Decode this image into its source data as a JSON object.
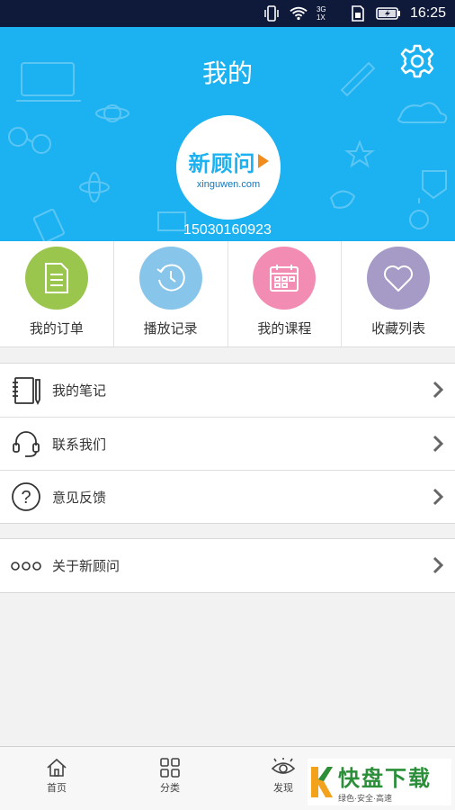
{
  "status_bar": {
    "network_label": "3G",
    "network_sub": "1X",
    "time": "16:25"
  },
  "header": {
    "title": "我的",
    "settings_icon": "gear-icon",
    "logo_name": "新顾问",
    "logo_url": "xinguwen.com",
    "phone": "15030160923",
    "background": "#1cb1f0"
  },
  "quick_actions": [
    {
      "label": "我的订单",
      "icon": "document-icon",
      "color": "#9bc64d"
    },
    {
      "label": "播放记录",
      "icon": "history-icon",
      "color": "#88c5ea"
    },
    {
      "label": "我的课程",
      "icon": "calendar-icon",
      "color": "#f38cb2"
    },
    {
      "label": "收藏列表",
      "icon": "heart-icon",
      "color": "#a69ac7"
    }
  ],
  "menu_group_1": [
    {
      "label": "我的笔记",
      "icon": "notebook-icon"
    },
    {
      "label": "联系我们",
      "icon": "headset-icon"
    },
    {
      "label": "意见反馈",
      "icon": "question-icon"
    }
  ],
  "menu_group_2": [
    {
      "label": "关于新顾问",
      "icon": "more-dots-icon"
    }
  ],
  "bottom_nav": [
    {
      "label": "首页",
      "icon": "home-icon"
    },
    {
      "label": "分类",
      "icon": "grid-icon"
    },
    {
      "label": "发现",
      "icon": "eye-icon"
    }
  ],
  "watermark": {
    "brand": "快盘下载",
    "tagline": "绿色·安全·高速"
  }
}
